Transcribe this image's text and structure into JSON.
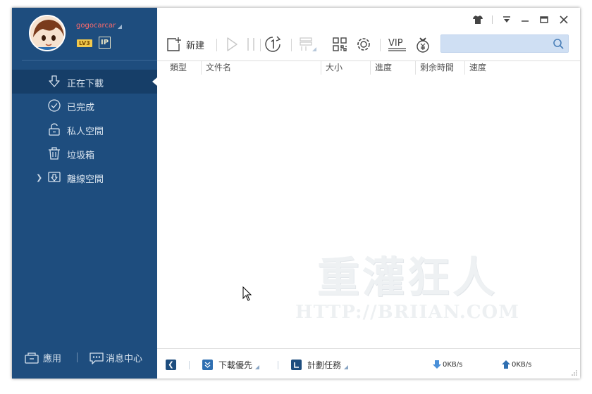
{
  "user": {
    "name": "gogocarcar",
    "level": "LV3",
    "vip_badge": "IP"
  },
  "sidebar": {
    "items": [
      {
        "label": "正在下載",
        "icon": "download-icon",
        "active": true
      },
      {
        "label": "已完成",
        "icon": "check-circle-icon",
        "active": false
      },
      {
        "label": "私人空間",
        "icon": "unlock-icon",
        "active": false
      },
      {
        "label": "垃圾箱",
        "icon": "trash-icon",
        "active": false
      },
      {
        "label": "離線空間",
        "icon": "offline-download-icon",
        "active": false,
        "expandable": true
      }
    ],
    "apps_label": "應用",
    "messages_label": "消息中心"
  },
  "toolbar": {
    "new_label": "新建",
    "vip_label": "VIP",
    "search": {
      "value": "",
      "placeholder": ""
    }
  },
  "table": {
    "columns": [
      "類型",
      "文件名",
      "大小",
      "進度",
      "剩余時間",
      "速度"
    ],
    "rows": []
  },
  "watermark": {
    "title": "重灌狂人",
    "url": "HTTP://BRIIAN.COM"
  },
  "statusbar": {
    "priority_label": "下載優先",
    "schedule_label": "計劃任務",
    "download_speed": "0KB/s",
    "upload_speed": "0KB/s"
  },
  "colors": {
    "sidebar_bg": "#1e4d7e",
    "sidebar_active": "#163e68",
    "accent_blue": "#2f6fb1",
    "username": "#ff6b6b",
    "search_bg": "#cfdff3"
  }
}
